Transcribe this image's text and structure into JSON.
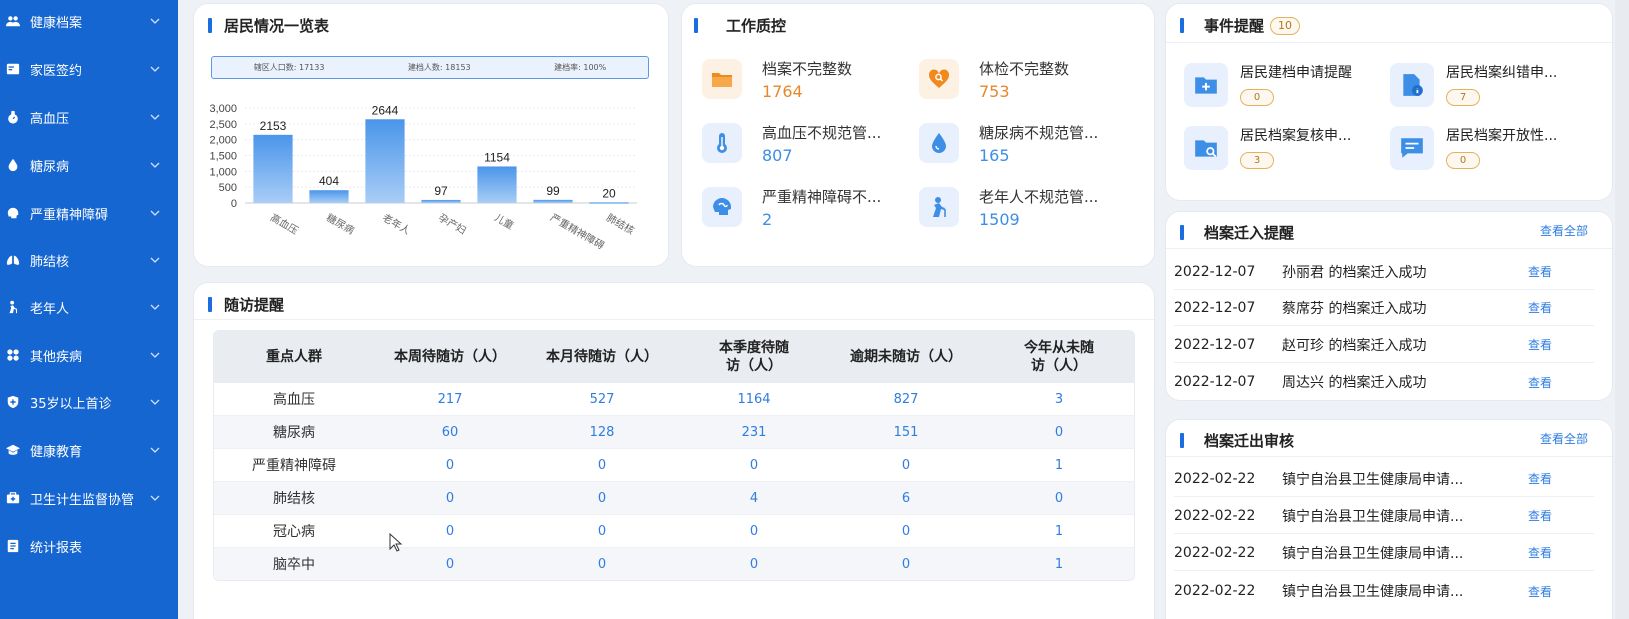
{
  "sidebar": {
    "items": [
      {
        "label": "健康档案",
        "icon": "users-icon"
      },
      {
        "label": "家医签约",
        "icon": "contract-icon"
      },
      {
        "label": "高血压",
        "icon": "pressure-icon"
      },
      {
        "label": "糖尿病",
        "icon": "drop-icon"
      },
      {
        "label": "严重精神障碍",
        "icon": "brain-icon"
      },
      {
        "label": "肺结核",
        "icon": "lung-icon"
      },
      {
        "label": "老年人",
        "icon": "elder-icon"
      },
      {
        "label": "其他疾病",
        "icon": "grid-icon"
      },
      {
        "label": "35岁以上首诊",
        "icon": "shield-icon"
      },
      {
        "label": "健康教育",
        "icon": "graduation-cap-icon"
      },
      {
        "label": "卫生计生监督协管",
        "icon": "medkit-icon"
      },
      {
        "label": "统计报表",
        "icon": "report-icon"
      }
    ]
  },
  "resident": {
    "title": "居民情况一览表",
    "summary": [
      "辖区人口数: 17133",
      "建档人数: 18153",
      "建档率: 100%"
    ]
  },
  "chart_data": {
    "type": "bar",
    "categories": [
      "高血压",
      "糖尿病",
      "老年人",
      "孕产妇",
      "儿童",
      "严重精神障碍",
      "肺结核"
    ],
    "values": [
      2153,
      404,
      2644,
      97,
      1154,
      99,
      20
    ],
    "ylim": [
      0,
      3000
    ],
    "yticks": [
      "0",
      "500",
      "1,000",
      "1,500",
      "2,000",
      "2,500",
      "3,000"
    ],
    "bar_color": "#4a95ea"
  },
  "qc": {
    "title": "工作质控",
    "items": [
      {
        "label": "档案不完整数",
        "value": "1764",
        "icon": "folder-icon",
        "color": "#e8872a"
      },
      {
        "label": "体检不完整数",
        "value": "753",
        "icon": "heart-search-icon",
        "color": "#e8872a"
      },
      {
        "label": "高血压不规范管...",
        "value": "807",
        "icon": "thermometer-icon",
        "color": "#3d8ee6"
      },
      {
        "label": "糖尿病不规范管...",
        "value": "165",
        "icon": "drop-icon",
        "color": "#3d8ee6"
      },
      {
        "label": "严重精神障碍不...",
        "value": "2",
        "icon": "brain-icon",
        "color": "#3d8ee6"
      },
      {
        "label": "老年人不规范管...",
        "value": "1509",
        "icon": "elder-icon",
        "color": "#3d8ee6"
      }
    ]
  },
  "followup": {
    "title": "随访提醒",
    "headers": [
      "重点人群",
      "本周待随访（人）",
      "本月待随访（人）",
      "本季度待随访（人）",
      "逾期未随访（人）",
      "今年从未随访（人）"
    ],
    "rows": [
      [
        "高血压",
        "217",
        "527",
        "1164",
        "827",
        "3"
      ],
      [
        "糖尿病",
        "60",
        "128",
        "231",
        "151",
        "0"
      ],
      [
        "严重精神障碍",
        "0",
        "0",
        "0",
        "0",
        "1"
      ],
      [
        "肺结核",
        "0",
        "0",
        "4",
        "6",
        "0"
      ],
      [
        "冠心病",
        "0",
        "0",
        "0",
        "0",
        "1"
      ],
      [
        "脑卒中",
        "0",
        "0",
        "0",
        "0",
        "1"
      ]
    ]
  },
  "events": {
    "title": "事件提醒",
    "count": "10",
    "items": [
      {
        "label": "居民建档申请提醒",
        "count": "0",
        "icon": "add-folder-icon"
      },
      {
        "label": "居民档案纠错申...",
        "count": "7",
        "icon": "document-info-icon"
      },
      {
        "label": "居民档案复核申...",
        "count": "3",
        "icon": "folder-search-icon"
      },
      {
        "label": "居民档案开放性...",
        "count": "0",
        "icon": "message-icon"
      }
    ]
  },
  "transfer_in": {
    "title": "档案迁入提醒",
    "view_all": "查看全部",
    "rows": [
      {
        "date": "2022-12-07",
        "text": "孙丽君 的档案迁入成功",
        "link": "查看"
      },
      {
        "date": "2022-12-07",
        "text": "蔡席芬 的档案迁入成功",
        "link": "查看"
      },
      {
        "date": "2022-12-07",
        "text": "赵可珍 的档案迁入成功",
        "link": "查看"
      },
      {
        "date": "2022-12-07",
        "text": "周达兴 的档案迁入成功",
        "link": "查看"
      }
    ]
  },
  "transfer_out": {
    "title": "档案迁出审核",
    "view_all": "查看全部",
    "rows": [
      {
        "date": "2022-02-22",
        "text": "镇宁自治县卫生健康局申请...",
        "link": "查看"
      },
      {
        "date": "2022-02-22",
        "text": "镇宁自治县卫生健康局申请...",
        "link": "查看"
      },
      {
        "date": "2022-02-22",
        "text": "镇宁自治县卫生健康局申请...",
        "link": "查看"
      },
      {
        "date": "2022-02-22",
        "text": "镇宁自治县卫生健康局申请...",
        "link": "查看"
      }
    ]
  }
}
